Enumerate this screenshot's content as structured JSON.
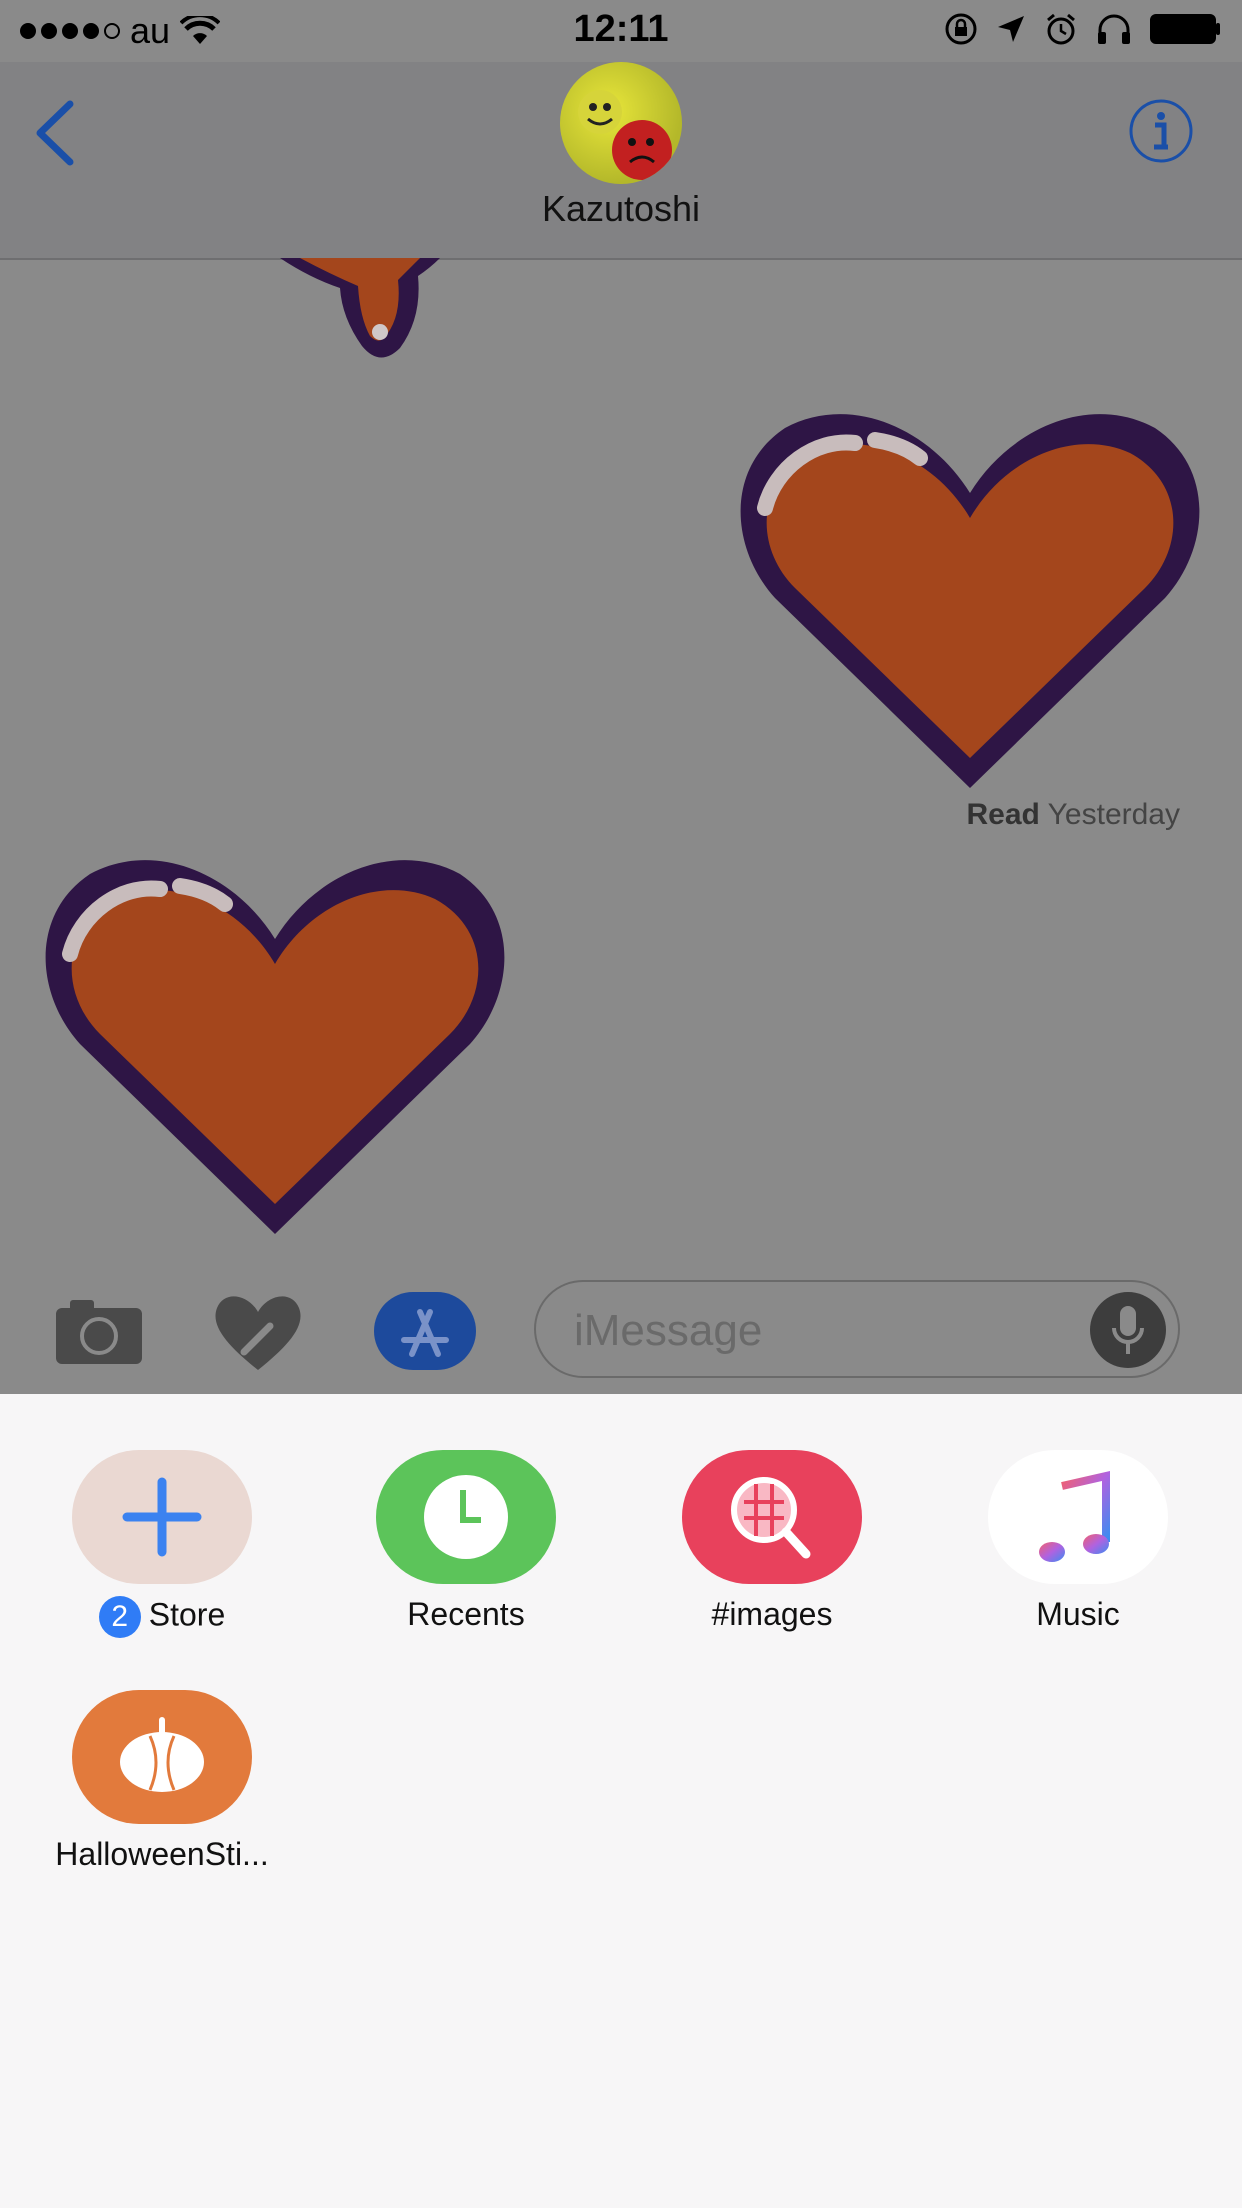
{
  "status_bar": {
    "carrier": "au",
    "time": "12:11"
  },
  "nav": {
    "contact_name": "Kazutoshi"
  },
  "conversation": {
    "read_label": "Read",
    "read_time": "Yesterday"
  },
  "compose": {
    "placeholder": "iMessage"
  },
  "app_drawer": {
    "apps": [
      {
        "label": "Store",
        "badge": "2",
        "icon": "plus-icon",
        "color": "#ead8d2"
      },
      {
        "label": "Recents",
        "icon": "clock-icon",
        "color": "#5cc45a"
      },
      {
        "label": "#images",
        "icon": "image-search-icon",
        "color": "#e8415c"
      },
      {
        "label": "Music",
        "icon": "music-note-icon",
        "color": "#ffffff"
      },
      {
        "label": "HalloweenSti...",
        "icon": "pumpkin-icon",
        "color": "#e27a3c"
      }
    ]
  },
  "colors": {
    "accent": "#1a4fa8",
    "heart_fill": "#a4461c",
    "heart_outline": "#2e1545"
  }
}
